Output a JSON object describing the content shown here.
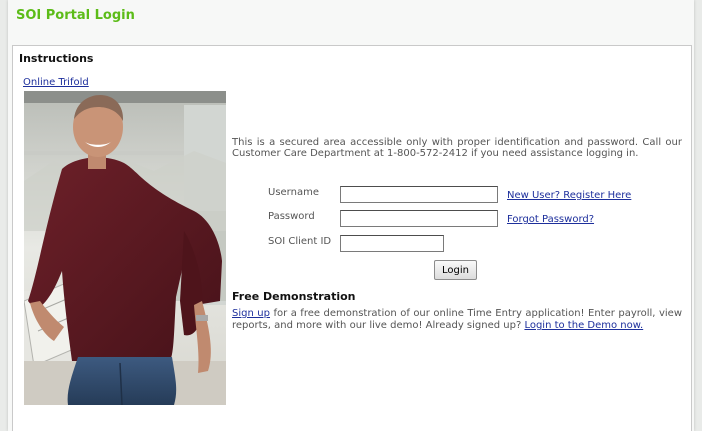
{
  "page": {
    "title": "SOI Portal Login"
  },
  "instructions": {
    "heading": "Instructions",
    "trifold_link": "Online Trifold"
  },
  "intro_text": "This is a secured area accessible only with proper identification and password. Call our Customer Care Department at 1-800-572-2412 if you need assistance logging in.",
  "form": {
    "username_label": "Username",
    "password_label": "Password",
    "client_id_label": "SOI Client ID",
    "username_value": "",
    "password_value": "",
    "client_id_value": "",
    "register_link": "New User? Register Here",
    "forgot_link": "Forgot Password?",
    "login_button": "Login"
  },
  "demo": {
    "heading": "Free Demonstration",
    "signup_link": "Sign up",
    "text": " for a free demonstration of our online Time Entry application! Enter payroll, view reports, and more with our live demo! Already signed up? ",
    "login_demo_link": "Login to the Demo now."
  },
  "colors": {
    "title_green": "#5cbc18",
    "link_blue": "#1d2f9c",
    "shirt_maroon": "#5e1a22"
  }
}
